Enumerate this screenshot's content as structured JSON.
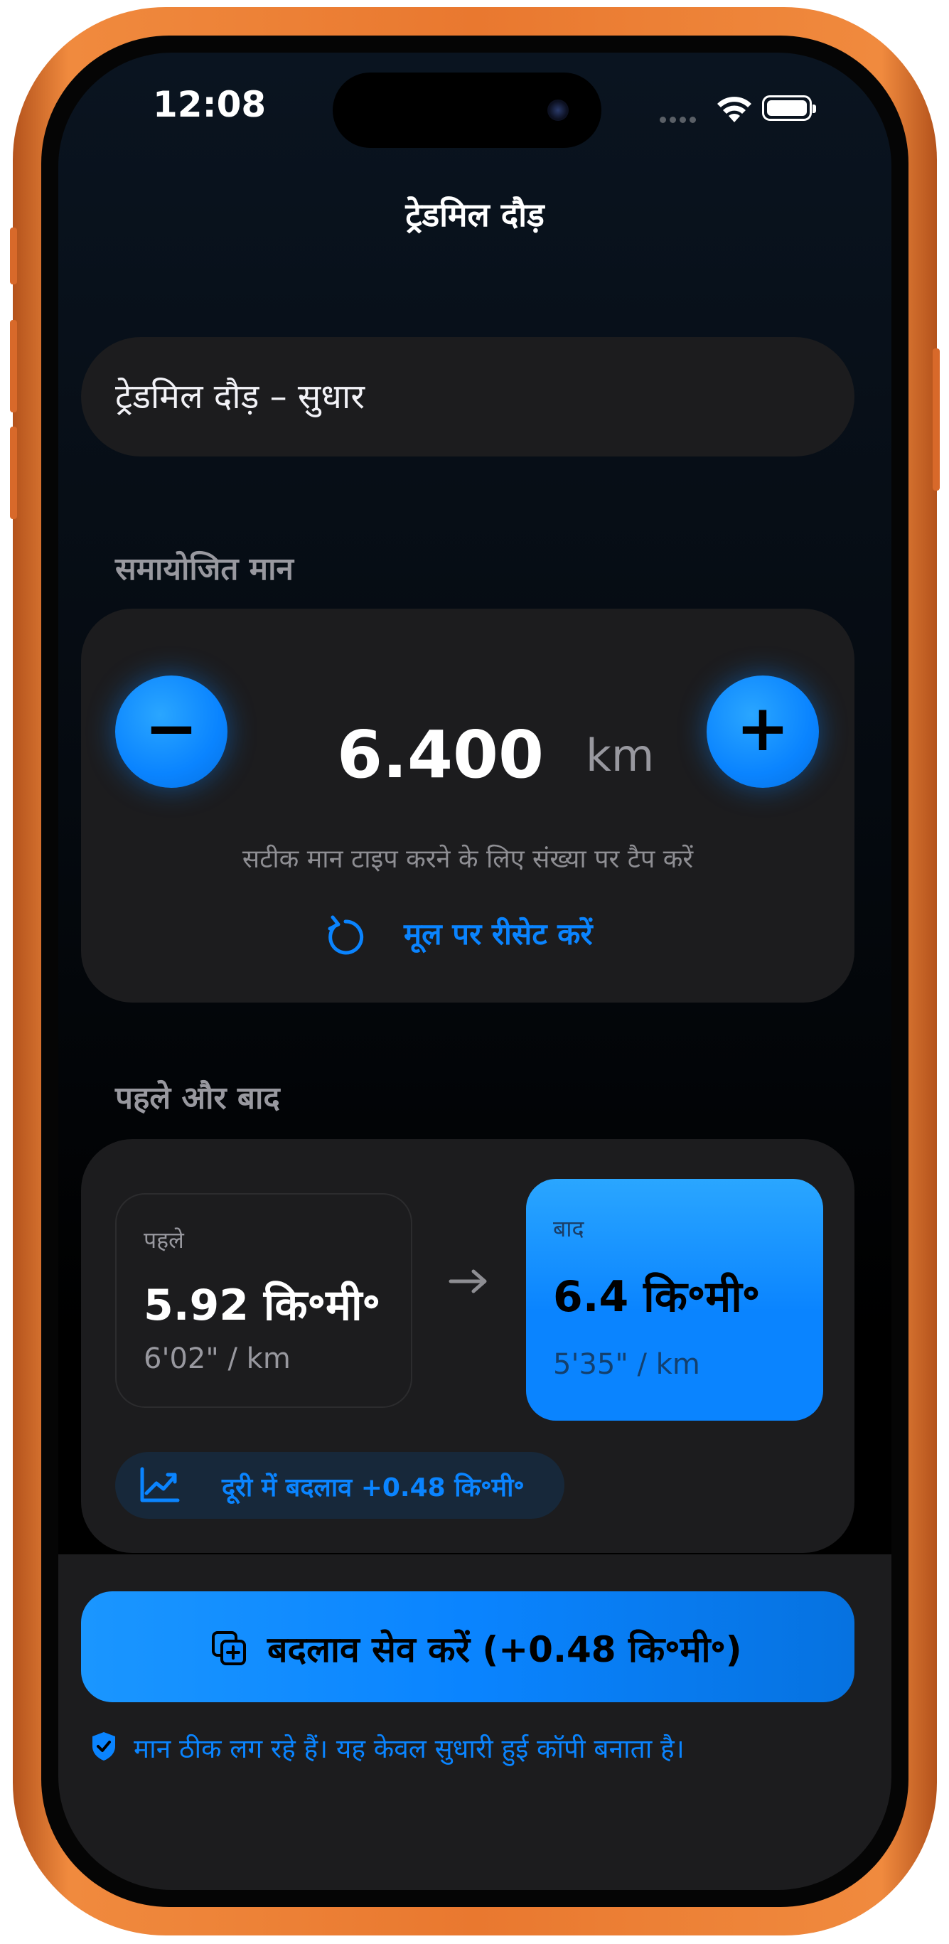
{
  "status_bar": {
    "time": "12:08"
  },
  "nav": {
    "title": "ट्रेडमिल दौड़"
  },
  "name_field": {
    "value": "ट्रेडमिल दौड़ – सुधार"
  },
  "adjust_section": {
    "label": "समायोजित मान",
    "minus_label": "−",
    "plus_label": "+",
    "value": "6.400",
    "unit": "km",
    "hint": "सटीक मान टाइप करने के लिए संख्या पर टैप करें",
    "reset_label": "मूल पर रीसेट करें"
  },
  "compare_section": {
    "label": "पहले और बाद",
    "before": {
      "caption": "पहले",
      "distance": "5.92 कि॰मी॰",
      "pace": "6'02\" / km"
    },
    "after": {
      "caption": "बाद",
      "distance": "6.4 कि॰मी॰",
      "pace": "5'35\" / km"
    },
    "delta": "दूरी में बदलाव +0.48 कि॰मी॰"
  },
  "save_button": {
    "label": "बदलाव सेव करें (+0.48 कि॰मी॰)"
  },
  "footer_note": "मान ठीक लग रहे हैं। यह केवल सुधारी हुई कॉपी बनाता है।",
  "colors": {
    "accent": "#0a84ff",
    "card": "#1c1c1e",
    "frame": "#e9782f"
  }
}
